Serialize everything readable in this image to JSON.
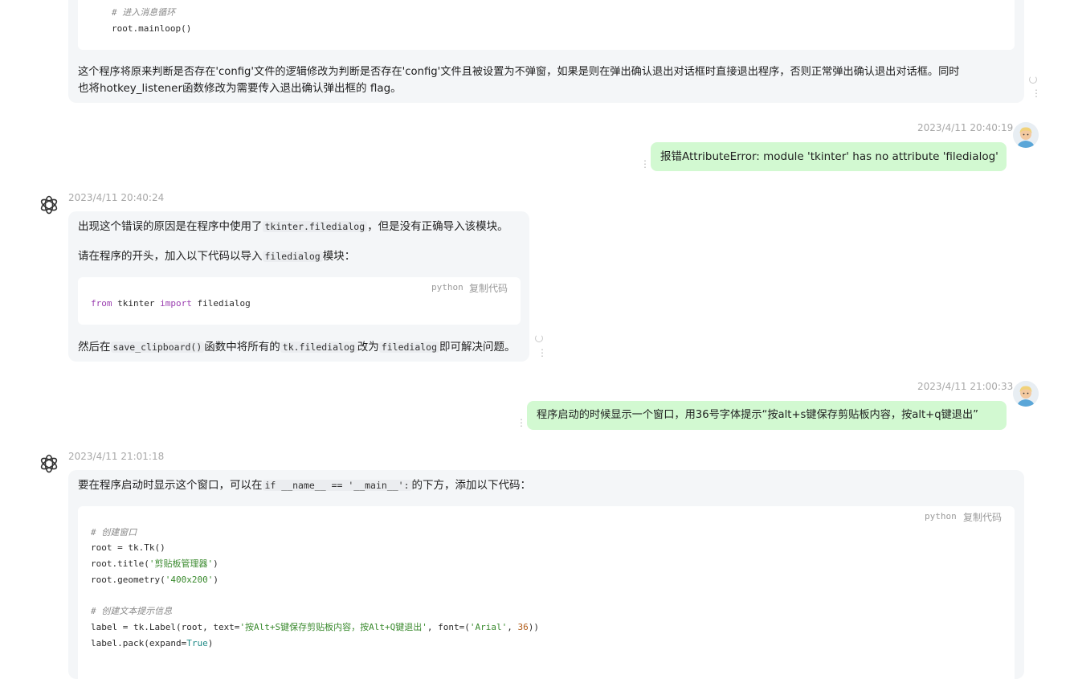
{
  "msg_prev": {
    "code_comment": "# 进入消息循环",
    "code_line": "root.mainloop()",
    "text_line1": "这个程序将原来判断是否存在'config'文件的逻辑修改为判断是否存在'config'文件且被设置为不弹窗，如果是则在弹出确认退出对话框时直接退出程序，否则正常弹出确认退出对话框。同时",
    "text_line2": "也将hotkey_listener函数修改为需要传入退出确认弹出框的 flag。"
  },
  "user1": {
    "timestamp": "2023/4/11 20:40:19",
    "text": "报错AttributeError: module 'tkinter' has no attribute 'filedialog'"
  },
  "bot1": {
    "timestamp": "2023/4/11 20:40:24",
    "p1_a": "出现这个错误的原因是在程序中使用了",
    "p1_code": "tkinter.filedialog",
    "p1_b": "，但是没有正确导入该模块。",
    "p2_a": "请在程序的开头，加入以下代码以导入",
    "p2_code": "filedialog",
    "p2_b": "模块：",
    "code_lang": "python",
    "copy_label": "复制代码",
    "code_kw1": "from",
    "code_mod": " tkinter ",
    "code_kw2": "import",
    "code_name": " filedialog",
    "p3_a": "然后在",
    "p3_code1": "save_clipboard()",
    "p3_b": "函数中将所有的",
    "p3_code2": "tk.filedialog",
    "p3_c": "改为",
    "p3_code3": "filedialog",
    "p3_d": "即可解决问题。"
  },
  "user2": {
    "timestamp": "2023/4/11 21:00:33",
    "text": "程序启动的时候显示一个窗口，用36号字体提示“按alt+s键保存剪贴板内容，按alt+q键退出”"
  },
  "bot2": {
    "timestamp": "2023/4/11 21:01:18",
    "p1_a": "要在程序启动时显示这个窗口，可以在",
    "p1_code": "if __name__ == '__main__':",
    "p1_b": "的下方，添加以下代码：",
    "code_lang": "python",
    "copy_label": "复制代码",
    "c1": "# 创建窗口",
    "c2": "root = tk.Tk()",
    "c3_a": "root.title(",
    "c3_s": "'剪贴板管理器'",
    "c3_b": ")",
    "c4_a": "root.geometry(",
    "c4_s": "'400x200'",
    "c4_b": ")",
    "c5": "# 创建文本提示信息",
    "c6_a": "label = tk.Label(root, text=",
    "c6_s": "'按Alt+S键保存剪贴板内容，按Alt+Q键退出'",
    "c6_b": ", font=(",
    "c6_s2": "'Arial'",
    "c6_c": ", ",
    "c6_n": "36",
    "c6_d": "))",
    "c7_a": "label.pack(expand=",
    "c7_bool": "True",
    "c7_b": ")"
  }
}
